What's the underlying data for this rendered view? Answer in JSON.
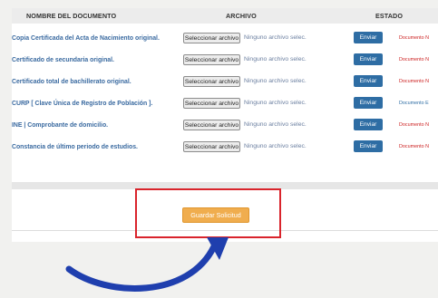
{
  "table": {
    "headers": {
      "document": "NOMBRE DEL DOCUMENTO",
      "file": "ARCHIVO",
      "status": "ESTADO"
    },
    "file_button_label": "Seleccionar archivo",
    "no_file_text": "Ninguno archivo selec.",
    "send_label": "Enviar",
    "rows": [
      {
        "document": "Copia Certificada del Acta de Nacimiento original.",
        "status": "Documento N",
        "status_color": "#cc1f1f"
      },
      {
        "document": "Certificado de secundaria original.",
        "status": "Documento N",
        "status_color": "#cc1f1f"
      },
      {
        "document": "Certificado total de bachillerato original.",
        "status": "Documento N",
        "status_color": "#cc1f1f"
      },
      {
        "document": "CURP [ Clave Única de Registro de Población ].",
        "status": "Documento E",
        "status_color": "#2e6da4"
      },
      {
        "document": "INE | Comprobante de domicilio.",
        "status": "Documento N",
        "status_color": "#cc1f1f"
      },
      {
        "document": "Constancia de último periodo de estudios.",
        "status": "Documento N",
        "status_color": "#cc1f1f"
      }
    ]
  },
  "actions": {
    "save_label": "Guardar Solicitud"
  },
  "colors": {
    "link_blue": "#3a6aa0",
    "send_blue": "#2e6da4",
    "save_orange": "#f0ad4e",
    "highlight_red": "#d9242c",
    "arrow_blue": "#1f3fae"
  },
  "annotations": {
    "highlight": "red-rectangle",
    "pointer": "curved-arrow"
  }
}
